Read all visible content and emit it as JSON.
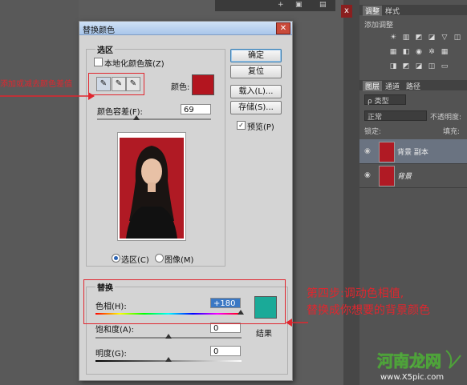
{
  "dialog": {
    "title": "替换颜色",
    "selection_group": "选区",
    "localized_color_clusters": "本地化颜色簇(Z)",
    "color_label": "颜色:",
    "color_swatch": "#b3151f",
    "fuzziness_label": "颜色容差(F):",
    "fuzziness_value": "69",
    "fuzziness_level": 69,
    "radio_selection": "选区(C)",
    "radio_image": "图像(M)",
    "replace_group": "替换",
    "hue_label": "色相(H):",
    "hue_value": "+180",
    "saturation_label": "饱和度(A):",
    "saturation_value": "0",
    "lightness_label": "明度(G):",
    "lightness_value": "0",
    "result_label": "结果",
    "result_swatch": "#1aaa98",
    "buttons": {
      "ok": "确定",
      "reset": "复位",
      "load": "载入(L)...",
      "save": "存储(S)..."
    },
    "preview_label": "预览(P)",
    "preview_checked": true,
    "close_icon": "close-icon"
  },
  "right_panel": {
    "tabs": [
      "调整",
      "样式"
    ],
    "add_adjustment": "添加调整",
    "layer_tabs": [
      "图层",
      "通道",
      "路径"
    ],
    "kind_filter": "ρ 类型",
    "blend_mode": "正常",
    "opacity_label": "不透明度:",
    "lock_label": "锁定:",
    "fill_label": "填充:",
    "layers": [
      {
        "name": "背景 副本"
      },
      {
        "name": "背景"
      }
    ],
    "close_x": "x"
  },
  "annotations": {
    "left_note": "添加或减去颜色差值",
    "step_line1": "第四步:调动色相值,",
    "step_line2": "替换成你想要的背景颜色"
  },
  "watermark": {
    "brand": "河南龙网",
    "url": "www.X5pic.com"
  },
  "colors": {
    "annotation_red": "#e0262e",
    "photo_bg": "#b01a24",
    "panel_bg": "#535353"
  }
}
